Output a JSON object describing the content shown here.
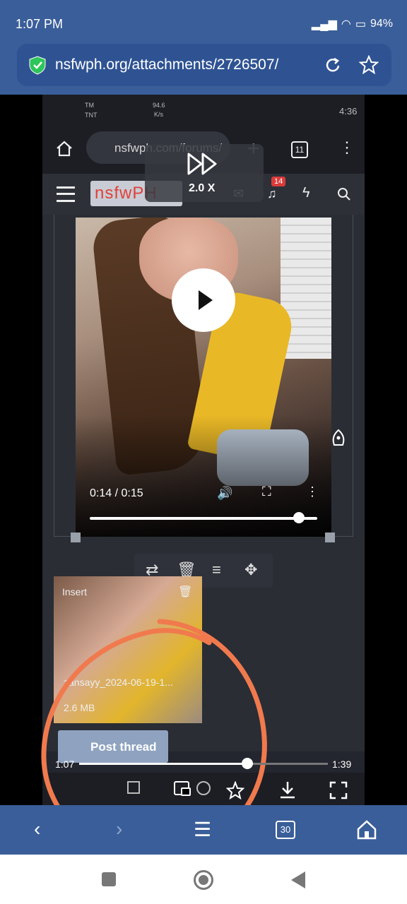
{
  "status_bar": {
    "time": "1:07 PM",
    "battery": "94%"
  },
  "browser": {
    "url": "nsfwph.org/attachments/2726507/",
    "tab_count": "30"
  },
  "video": {
    "current_time": "1:07",
    "duration": "1:39",
    "progress": 0.676,
    "playback_speed": "2.0 X",
    "inner_screen": {
      "status_carrier_1": "TM",
      "status_carrier_2": "TNT",
      "status_speed_value": "94.6",
      "status_speed_unit": "K/s",
      "status_time": "4:36",
      "url": "nsfwph.com/forums/",
      "tab_count": "11",
      "logo_text": "nsfwPH",
      "notification_count": "14",
      "embedded_player": {
        "time": "0:14 / 0:15",
        "progress": 0.93
      },
      "attachment": {
        "insert_label": "Insert",
        "filename": "zansayy_2024-06-19-1...",
        "size": "2.6 MB"
      },
      "post_button": "Post thread"
    }
  },
  "colors": {
    "browser_bar": "#3a5e99",
    "annotation_circle": "#f07a4e"
  }
}
